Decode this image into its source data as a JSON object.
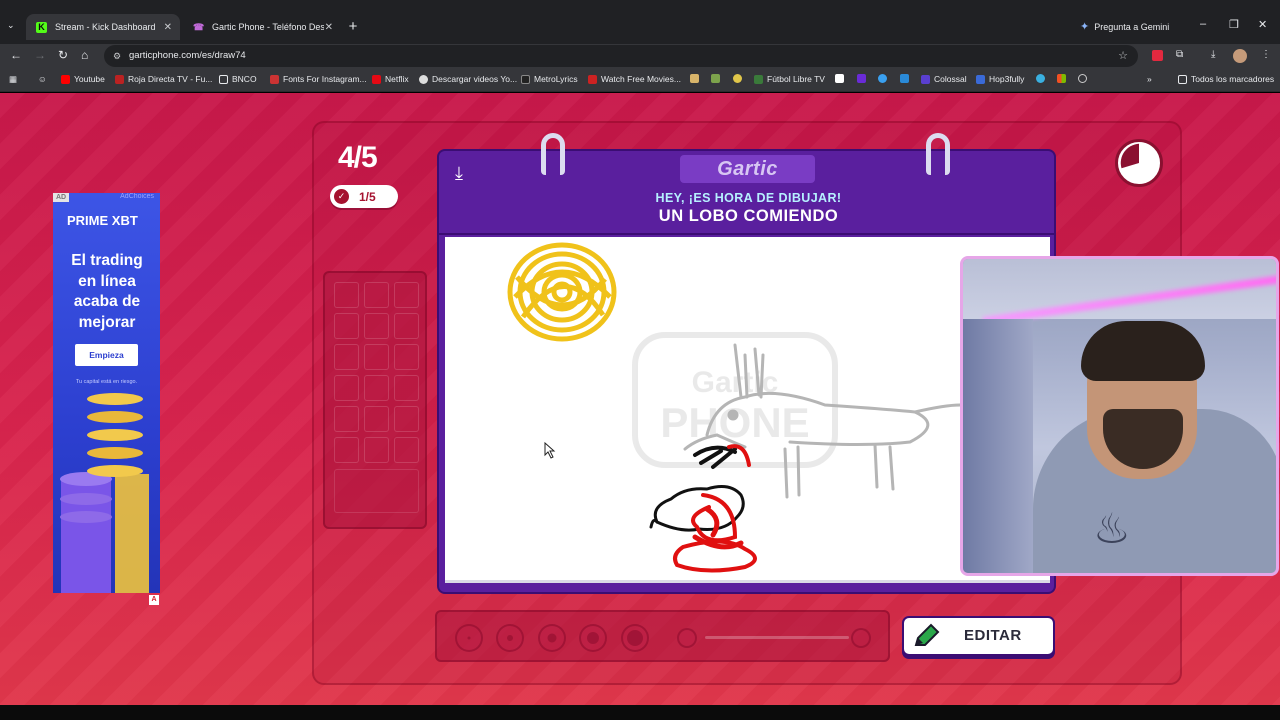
{
  "browser": {
    "tabs": [
      {
        "title": "Stream - Kick Dashboard",
        "active": true
      },
      {
        "title": "Gartic Phone - Teléfono Descon",
        "active": false
      }
    ],
    "gemini_label": "Pregunta a Gemini",
    "url": "garticphone.com/es/draw74",
    "bookmarks": [
      "Youtube",
      "Roja Directa TV - Fu...",
      "BNCO",
      "Fonts For Instagram...",
      "Netflix",
      "Descargar videos Yo...",
      "MetroLyrics",
      "Watch Free Movies...",
      "Fútbol Libre TV",
      "Colossal",
      "Hop3fully",
      "Todos los marcadores"
    ],
    "colors": {
      "brand_purple": "#5a1f9e",
      "page_red": "#d8244d",
      "accent_cyan": "#b6f0ff"
    }
  },
  "game": {
    "round": "4/5",
    "done_count": "1/5",
    "logo": "Gartic",
    "prompt_sub": "HEY, ¡ES HORA DE DIBUJAR!",
    "prompt_word": "UN LOBO COMIENDO",
    "edit_label": "EDITAR",
    "watermark": "Gartic PHONE"
  },
  "ad": {
    "tag": "AD",
    "adchoices": "AdChoices",
    "brand": "PRIME XBT",
    "headline": "El trading en línea acaba de mejorar",
    "cta": "Empieza",
    "disclaimer": "Tu capital está en riesgo."
  }
}
